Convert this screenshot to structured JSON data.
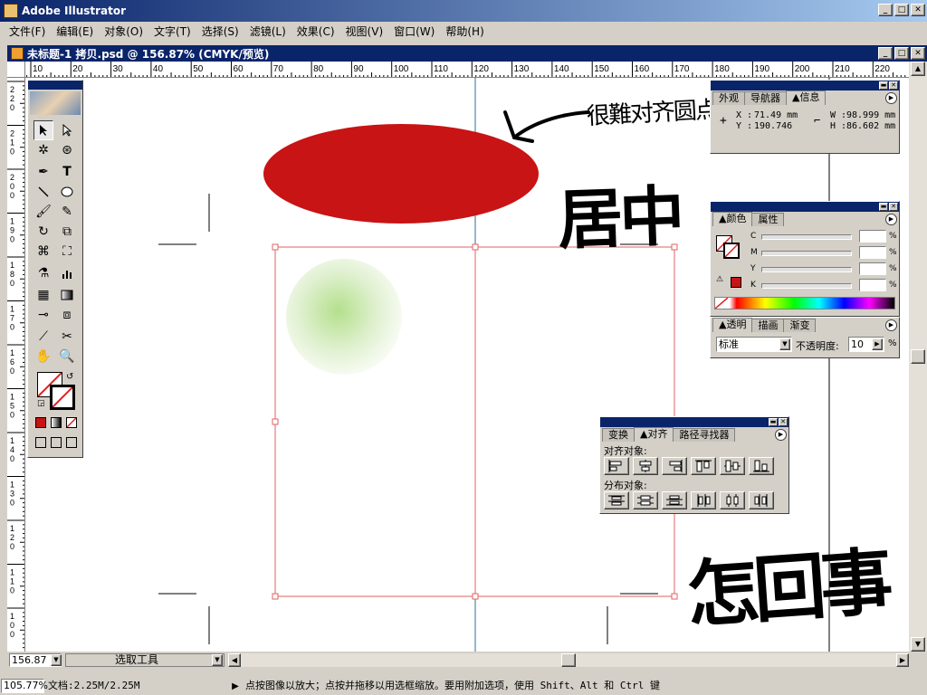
{
  "app": {
    "title": "Adobe Illustrator"
  },
  "menu": [
    "文件(F)",
    "编辑(E)",
    "对象(O)",
    "文字(T)",
    "选择(S)",
    "滤镜(L)",
    "效果(C)",
    "视图(V)",
    "窗口(W)",
    "帮助(H)"
  ],
  "document": {
    "title": "未标题-1 拷贝.psd @ 156.87% (CMYK/预览)"
  },
  "ruler": {
    "h_labels": [
      "10",
      "20",
      "30",
      "40",
      "50",
      "60",
      "70",
      "80",
      "90",
      "100",
      "110",
      "120",
      "130",
      "140",
      "150",
      "160",
      "170",
      "180",
      "190",
      "200",
      "210",
      "220"
    ],
    "v_labels": [
      "220",
      "210",
      "200",
      "190",
      "180",
      "170",
      "160",
      "150",
      "140",
      "130",
      "120",
      "110",
      "100"
    ]
  },
  "annotations": {
    "note1": "很難对齐圆点",
    "note2": "居中",
    "note3": "怎回事"
  },
  "info_panel": {
    "tabs": [
      "外观",
      "导航器",
      "信息"
    ],
    "x_label": "X :",
    "x_value": "71.49 mm",
    "y_label": "Y :",
    "y_value": "190.746",
    "w_label": "W :",
    "w_value": "98.999 mm",
    "h_label": "H :",
    "h_value": "86.602 mm"
  },
  "color_panel": {
    "tabs": [
      "颜色",
      "属性"
    ],
    "channels": [
      "C",
      "M",
      "Y",
      "K"
    ],
    "unit": "%"
  },
  "transparency_panel": {
    "tabs": [
      "透明",
      "描画",
      "渐变"
    ],
    "mode": "标准",
    "opacity_label": "不透明度:",
    "opacity_value": "10",
    "unit": "%"
  },
  "align_panel": {
    "tabs": [
      "变换",
      "对齐",
      "路径寻找器"
    ],
    "align_label": "对齐对象:",
    "distribute_label": "分布对象:"
  },
  "zoom_box": {
    "value": "156.87"
  },
  "tool_status": {
    "value": "选取工具"
  },
  "status": {
    "zoom": "105.77%",
    "doc": "文档:2.25M/2.25M",
    "hint": "点按图像以放大；点按并拖移以用选框缩放。要用附加选项，使用 Shift、Alt 和 Ctrl 键"
  },
  "colors": {
    "ellipse_fill": "#c81414",
    "selection": "#e06060",
    "guide": "#2a6f8f",
    "gradient_center": "#b4e08c",
    "titlebar": "#0a246a"
  }
}
